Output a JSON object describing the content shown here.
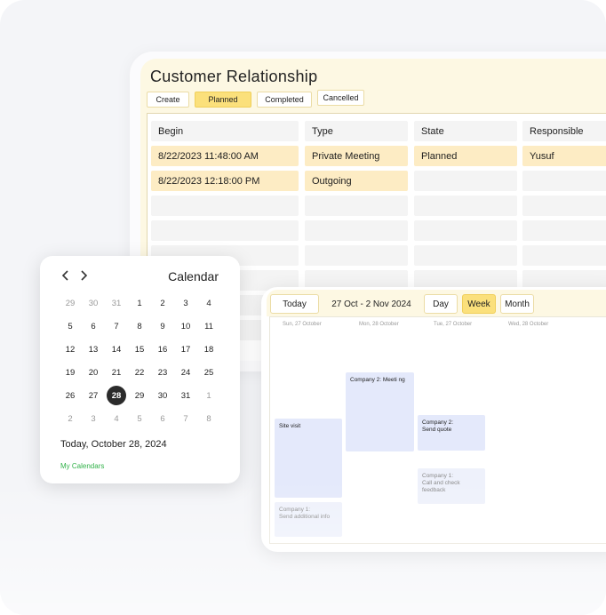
{
  "crm": {
    "title": "Customer Relationship",
    "tabs": {
      "create": "Create",
      "planned": "Planned",
      "completed": "Completed",
      "cancelled": "Cancelled"
    },
    "columns": [
      "Begin",
      "Type",
      "State",
      "Responsible"
    ],
    "rows": [
      [
        "8/22/2023 11:48:00 AM",
        "Private Meeting",
        "Planned",
        "Yusuf"
      ],
      [
        "8/22/2023 12:18:00 PM",
        "Outgoing",
        "",
        ""
      ]
    ],
    "colors": {
      "accent": "#fbe07b",
      "row_highlight": "#fdecc4",
      "panel": "#fdf8e3"
    }
  },
  "calendar": {
    "prev_icon": "chevron-left-icon",
    "next_icon": "chevron-right-icon",
    "title": "Calendar",
    "weeks": [
      [
        "29",
        "30",
        "31",
        "1",
        "2",
        "3",
        "4"
      ],
      [
        "5",
        "6",
        "7",
        "8",
        "9",
        "10",
        "11"
      ],
      [
        "12",
        "13",
        "14",
        "15",
        "16",
        "17",
        "18"
      ],
      [
        "19",
        "20",
        "21",
        "22",
        "23",
        "24",
        "25"
      ],
      [
        "26",
        "27",
        "28",
        "29",
        "30",
        "31",
        "1"
      ],
      [
        "2",
        "3",
        "4",
        "5",
        "6",
        "7",
        "8"
      ]
    ],
    "selected_day": "28",
    "today_text": "Today, October 28, 2024",
    "my_calendars": "My Calendars",
    "link_color": "#32b24a"
  },
  "week": {
    "today": "Today",
    "range": "27 Oct - 2 Nov 2024",
    "views": {
      "day": "Day",
      "week": "Week",
      "month": "Month"
    },
    "active_view": "Week",
    "days": [
      "Sun, 27 October",
      "Mon, 28 October",
      "Tue, 27 October",
      "Wed, 28 October"
    ],
    "events": {
      "site_visit": "Site visit",
      "send_info": "Company 1:\nSend additional info",
      "meeting": "Company 2: Meeti ng",
      "send_quote": "Company 2:\nSend quote",
      "feedback": "Company 1:\nCall and check feedback"
    },
    "event_color": "#e4e9fb"
  }
}
